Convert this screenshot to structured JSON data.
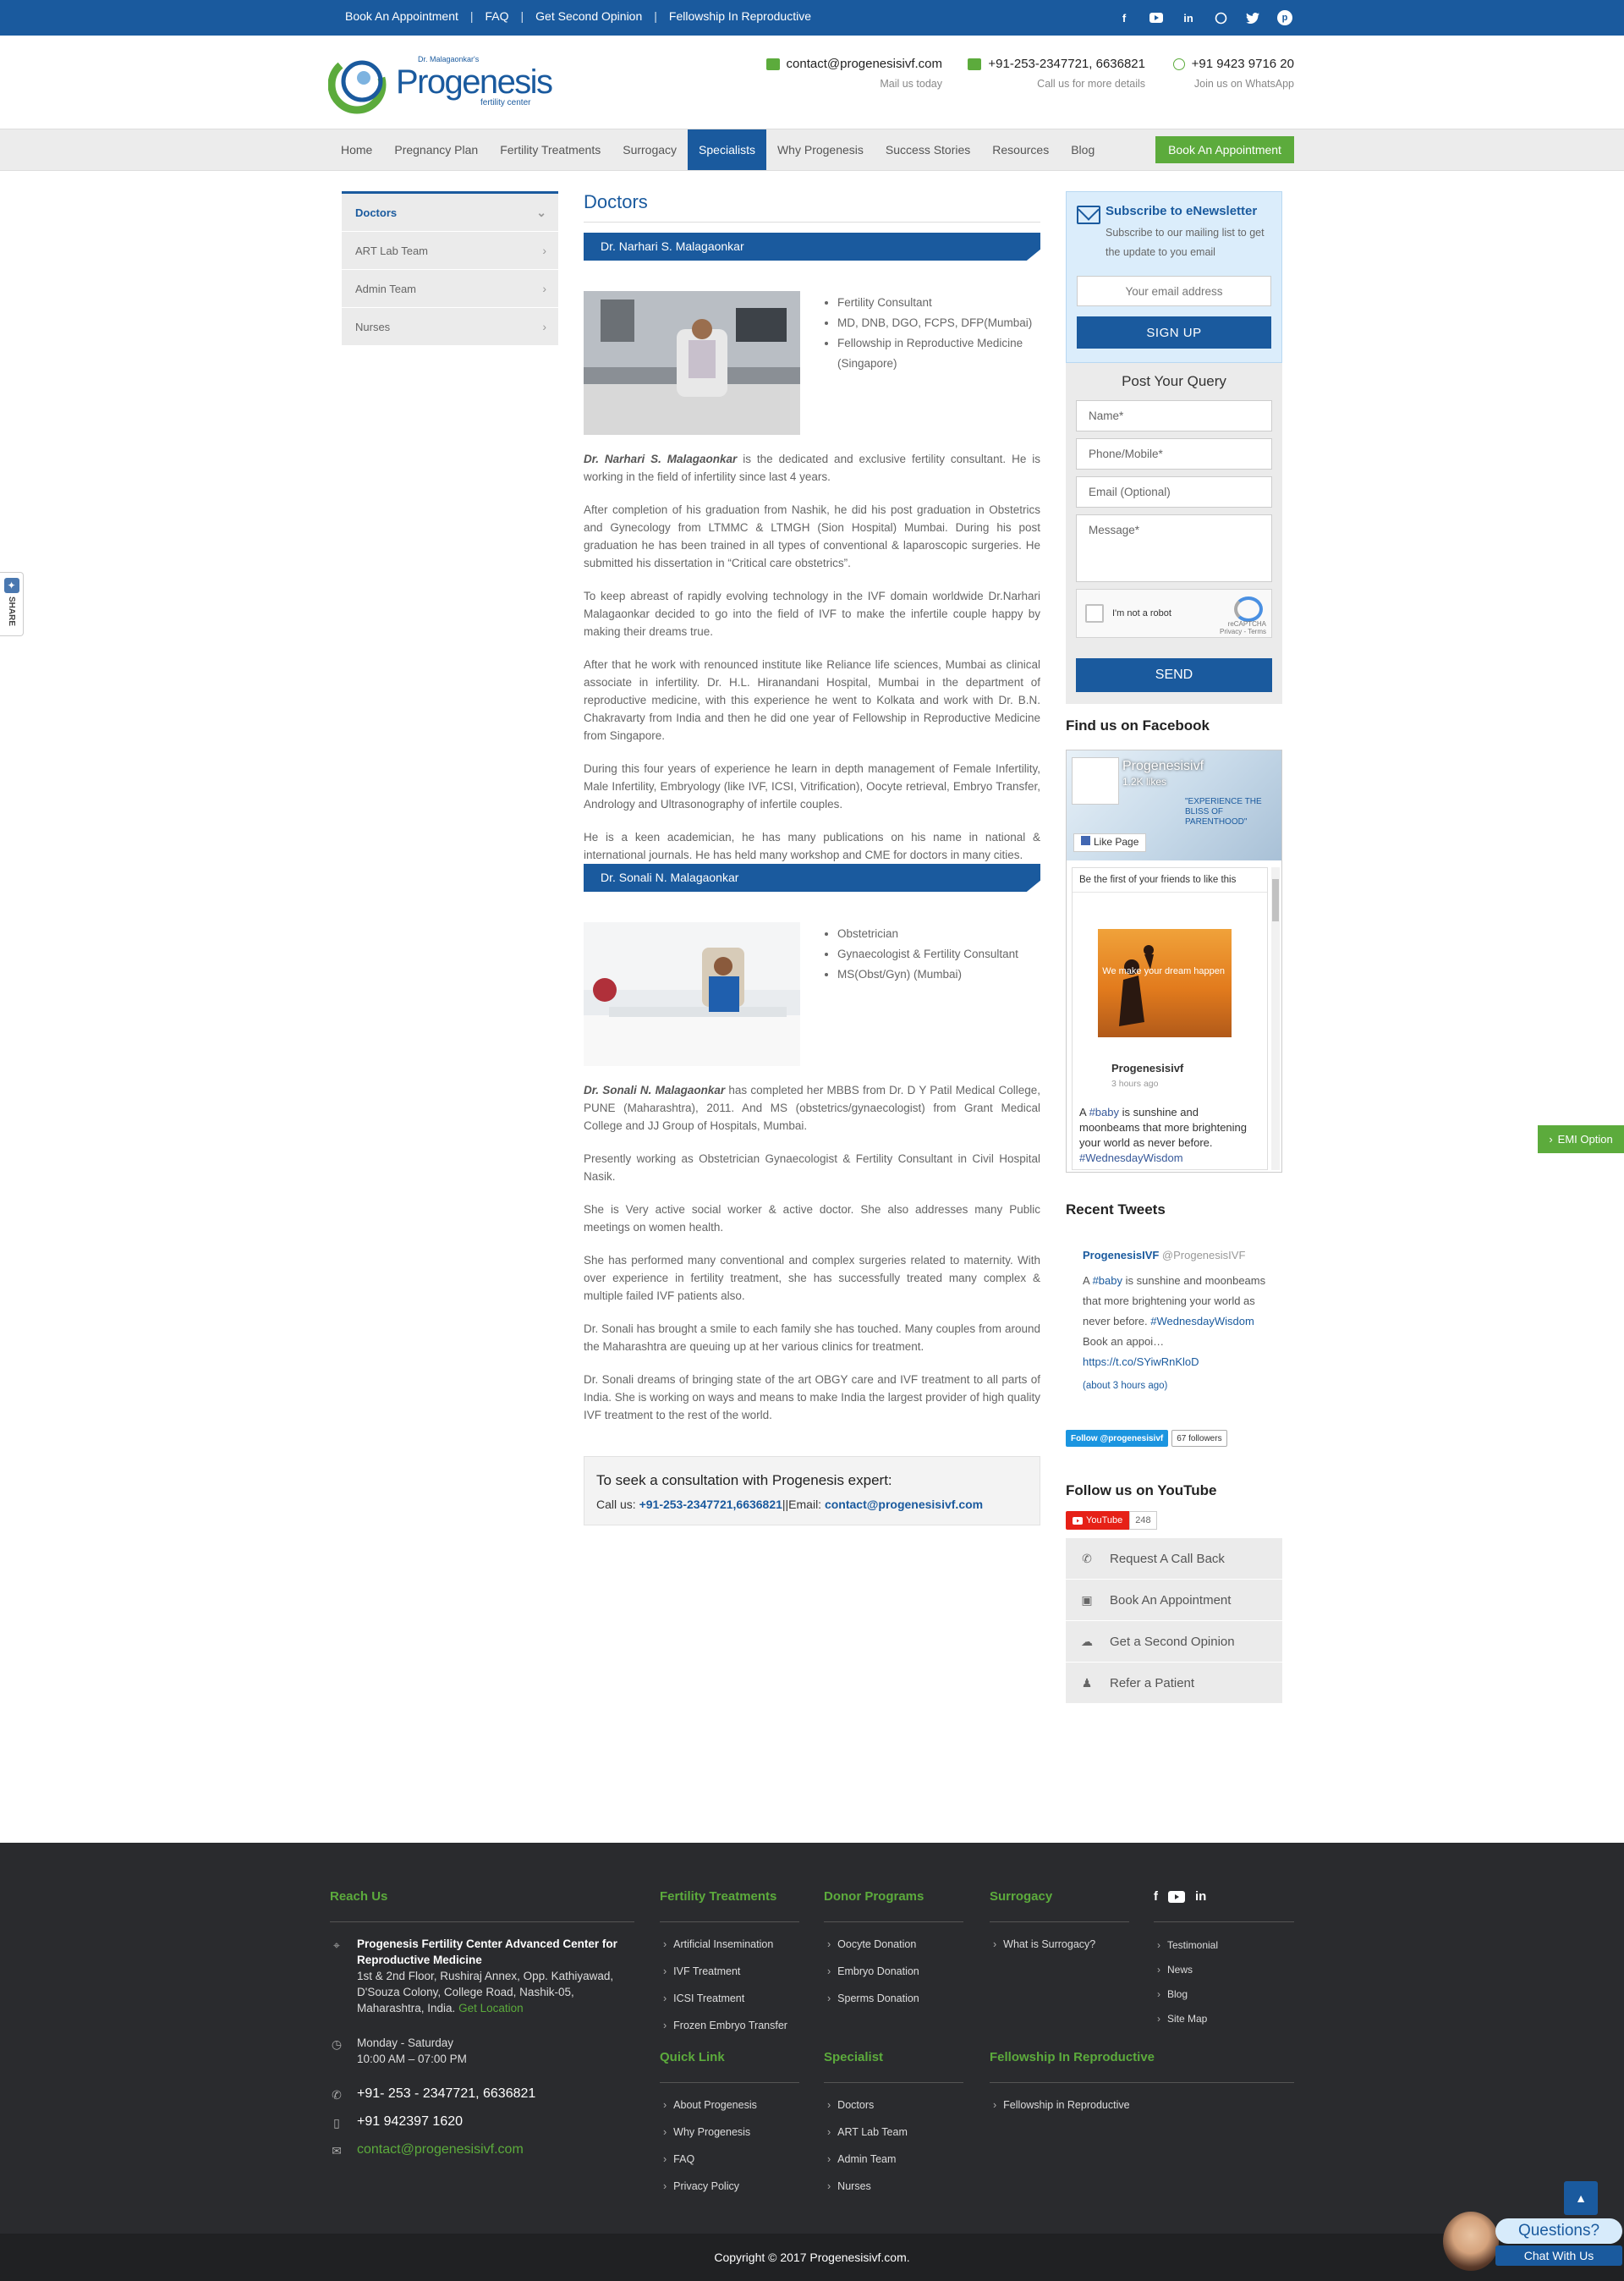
{
  "topbar": {
    "links": [
      "Book An Appointment",
      "FAQ",
      "Get Second Opinion",
      "Fellowship In Reproductive"
    ],
    "social_icons": [
      "facebook-icon",
      "youtube-icon",
      "linkedin-icon",
      "whatsapp-icon",
      "twitter-icon",
      "pinterest-icon"
    ]
  },
  "header": {
    "logo_top": "Dr. Malagaonkar's",
    "logo_name": "Progenesis",
    "logo_sub": "fertility center",
    "email": "contact@progenesisivf.com",
    "email_sub": "Mail us today",
    "phone": "+91-253-2347721, 6636821",
    "phone_sub": "Call us for more details",
    "whatsapp": "+91 9423 9716 20",
    "whatsapp_sub": "Join us on WhatsApp"
  },
  "nav": {
    "items": [
      "Home",
      "Pregnancy Plan",
      "Fertility Treatments",
      "Surrogacy",
      "Specialists",
      "Why Progenesis",
      "Success Stories",
      "Resources",
      "Blog"
    ],
    "active": "Specialists",
    "cta": "Book An Appointment"
  },
  "sidenav": {
    "items": [
      "Doctors",
      "ART Lab Team",
      "Admin Team",
      "Nurses"
    ]
  },
  "main": {
    "title": "Doctors",
    "doctors": [
      {
        "name": "Dr. Narhari S. Malagaonkar",
        "quals": [
          "Fertility Consultant",
          "MD, DNB, DGO, FCPS, DFP(Mumbai)",
          "Fellowship in Reproductive Medicine (Singapore)"
        ],
        "lead_name": "Dr. Narhari S. Malagaonkar",
        "lead_rest": " is the dedicated and exclusive fertility consultant. He is working in the field of infertility since last 4 years.",
        "paras": [
          "After completion of his graduation from Nashik, he did his post graduation in Obstetrics and Gynecology from LTMMC & LTMGH (Sion Hospital) Mumbai. During his post graduation he has been trained in all types of conventional & laparoscopic surgeries. He submitted his dissertation in “Critical care obstetrics”.",
          "To keep abreast of rapidly evolving technology in the IVF domain worldwide Dr.Narhari Malagaonkar decided to go into the field of IVF to make the infertile couple happy by making their dreams true.",
          "After that he work with renounced institute like Reliance life sciences, Mumbai as clinical associate in infertility. Dr. H.L. Hiranandani Hospital, Mumbai in the department of reproductive medicine, with this experience he went to Kolkata and work with Dr. B.N. Chakravarty from India and then he did one year of Fellowship in Reproductive Medicine from Singapore.",
          "During this four years of experience he learn in depth management of Female Infertility, Male Infertility, Embryology (like IVF, ICSI, Vitrification), Oocyte retrieval, Embryo Transfer, Andrology and Ultrasonography of infertile couples.",
          "He is a keen academician, he has many publications on his name in national & international journals. He has held many workshop and CME for doctors in many cities."
        ]
      },
      {
        "name": "Dr. Sonali N. Malagaonkar",
        "quals": [
          "Obstetrician",
          "Gynaecologist & Fertility Consultant",
          "MS(Obst/Gyn) (Mumbai)"
        ],
        "lead_name": "Dr. Sonali N. Malagaonkar",
        "lead_rest": " has completed her MBBS from Dr. D Y Patil Medical College, PUNE (Maharashtra), 2011. And  MS (obstetrics/gynaecologist) from Grant Medical College and JJ Group of Hospitals, Mumbai.",
        "paras": [
          "Presently working as Obstetrician Gynaecologist & Fertility Consultant in Civil Hospital Nasik.",
          "She is Very active social worker & active doctor. She also addresses many Public meetings on women health.",
          "She has performed many conventional and complex surgeries related to maternity. With over experience in fertility treatment, she has successfully treated many complex &  multiple failed IVF patients also.",
          "Dr.  Sonali has brought a smile to each family she has touched. Many couples from around the Maharashtra are queuing up at her various clinics for treatment.",
          "Dr.  Sonali dreams of bringing state of the art OBGY care and IVF treatment to all parts of India. She is working on ways and means to make India the largest provider of high quality IVF treatment to the rest of the world."
        ]
      }
    ],
    "cta_title": "To seek a consultation with Progenesis expert:",
    "cta_call_label": "Call us: ",
    "cta_phone": "+91-253-2347721,6636821",
    "cta_sep": "||Email: ",
    "cta_email": "contact@progenesisivf.com"
  },
  "newsletter": {
    "title": "Subscribe to eNewsletter",
    "desc": "Subscribe to our mailing list to get the update to you email",
    "placeholder": "Your email address",
    "button": "SIGN UP"
  },
  "query": {
    "title": "Post Your Query",
    "name": "Name*",
    "phone": "Phone/Mobile*",
    "email": "Email (Optional)",
    "message": "Message*",
    "captcha_label": "I'm not a robot",
    "captcha_brand": "reCAPTCHA",
    "captcha_terms": "Privacy - Terms",
    "send": "SEND"
  },
  "facebook": {
    "heading": "Find us on Facebook",
    "page_name": "Progenesisivf",
    "likes": "1.2K likes",
    "slogan": "\"EXPERIENCE THE BLISS OF PARENTHOOD\"",
    "like_button": "Like Page",
    "friends": "Be the first of your friends to like this",
    "image_text": "We make your dream happen",
    "post_name": "Progenesisivf",
    "post_time": "3 hours ago",
    "post_body": "A ",
    "post_hash1": "#baby",
    "post_body2": " is sunshine and moonbeams that more brightening your world as never before. ",
    "post_hash2": "#WednesdayWisdom"
  },
  "tweets": {
    "heading": "Recent Tweets",
    "handle_name": "ProgenesisIVF",
    "handle": " @ProgenesisIVF",
    "text1": "A ",
    "hash1": "#baby",
    "text2": " is sunshine and moonbeams that more brightening your world as never before. ",
    "hash2": "#WednesdayWisdom",
    "text3": " Book an appoi…",
    "link": "https://t.co/SYiwRnKloD",
    "time": "(about 3 hours ago)",
    "follow": "Follow @progenesisivf",
    "followers": "67 followers"
  },
  "youtube": {
    "heading": "Follow us on YouTube",
    "button": "YouTube",
    "count": "248"
  },
  "quicklinks": [
    {
      "label": "Request A Call Back",
      "icon": "phone-icon"
    },
    {
      "label": "Book An Appointment",
      "icon": "calendar-icon"
    },
    {
      "label": "Get a Second Opinion",
      "icon": "chat-icon"
    },
    {
      "label": "Refer a Patient",
      "icon": "user-icon"
    }
  ],
  "share": {
    "label": "SHARE"
  },
  "emi": {
    "label": "EMI Option"
  },
  "footer": {
    "reach_title": "Reach Us",
    "addr_title": "Progenesis Fertility Center Advanced Center for Reproductive Medicine",
    "addr": "1st & 2nd Floor, Rushiraj Annex, Opp. Kathiyawad, D'Souza Colony, College Road, Nashik-05, Maharashtra, India.",
    "get_location": "Get Location",
    "days": "Monday - Saturday",
    "hours": "10:00 AM – 07:00 PM",
    "phone": "+91- 253 - 2347721, 6636821",
    "mobile": "+91 942397 1620",
    "email": "contact@progenesisivf.com",
    "fertility_title": "Fertility Treatments",
    "fertility": [
      "Artificial Insemination",
      "IVF Treatment",
      "ICSI Treatment",
      "Frozen Embryo Transfer"
    ],
    "donor_title": "Donor Programs",
    "donor": [
      "Oocyte Donation",
      "Embryo Donation",
      "Sperms Donation"
    ],
    "surrogacy_title": "Surrogacy",
    "surrogacy": [
      "What is Surrogacy?"
    ],
    "misc": [
      "Testimonial",
      "News",
      "Blog",
      "Site Map"
    ],
    "quick_title": "Quick Link",
    "quick": [
      "About Progenesis",
      "Why Progenesis",
      "FAQ",
      "Privacy Policy"
    ],
    "specialist_title": "Specialist",
    "specialist": [
      "Doctors",
      "ART Lab Team",
      "Admin Team",
      "Nurses"
    ],
    "fellowship_title": "Fellowship In Reproductive",
    "fellowship": [
      "Fellowship in Reproductive"
    ],
    "copyright": "Copyright © 2017 Progenesisivf.com."
  },
  "chat": {
    "question": "Questions?",
    "chat": "Chat With Us"
  },
  "colors": {
    "primary": "#1a5a9e",
    "accent": "#5cab3c",
    "footer": "#2a2b2e"
  }
}
